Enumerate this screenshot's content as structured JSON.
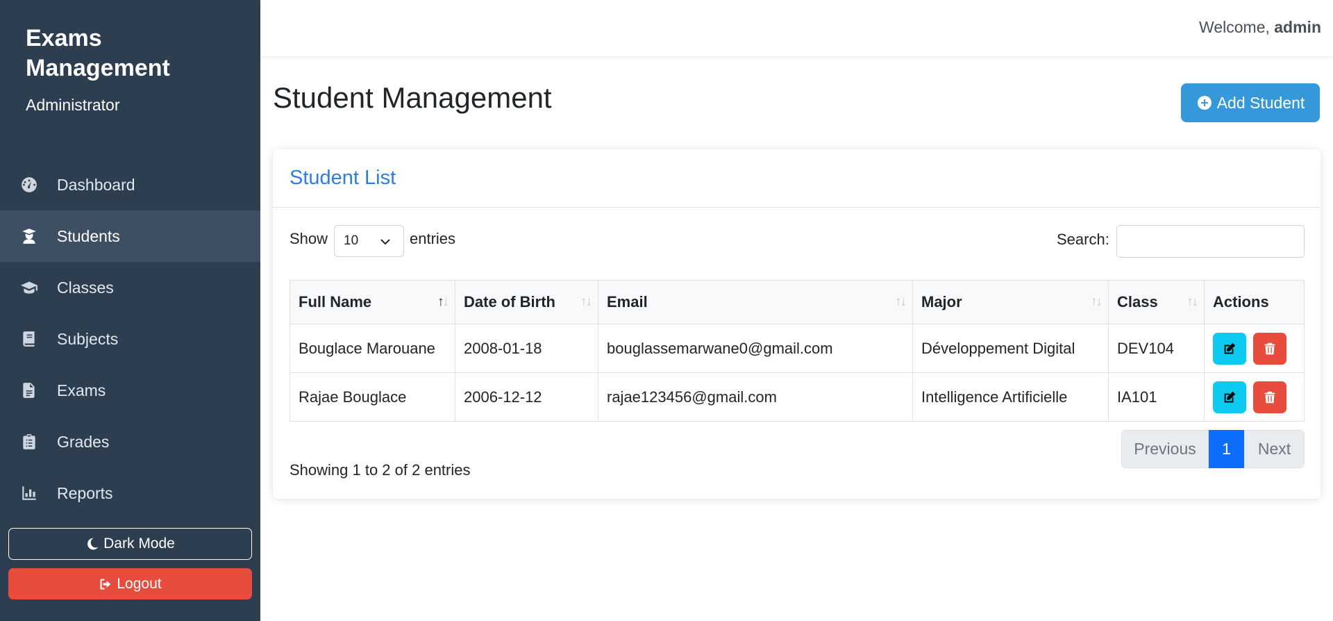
{
  "sidebar": {
    "brand_title": "Exams Management",
    "brand_subtitle": "Administrator",
    "items": [
      {
        "label": "Dashboard",
        "icon": "dashboard-gauge-icon"
      },
      {
        "label": "Students",
        "icon": "student-icon",
        "active": true
      },
      {
        "label": "Classes",
        "icon": "graduation-cap-icon"
      },
      {
        "label": "Subjects",
        "icon": "book-icon"
      },
      {
        "label": "Exams",
        "icon": "file-icon"
      },
      {
        "label": "Grades",
        "icon": "clipboard-icon"
      },
      {
        "label": "Reports",
        "icon": "bar-chart-icon"
      }
    ],
    "dark_mode_label": "Dark Mode",
    "logout_label": "Logout"
  },
  "header": {
    "welcome_prefix": "Welcome,",
    "username": "admin"
  },
  "main": {
    "page_title": "Student Management",
    "add_button_label": "Add Student",
    "card_title": "Student List",
    "show_label": "Show",
    "entries_value": "10",
    "entries_label": "entries",
    "search_label": "Search:",
    "search_value": "",
    "table": {
      "columns": [
        "Full Name",
        "Date of Birth",
        "Email",
        "Major",
        "Class",
        "Actions"
      ],
      "rows": [
        [
          "Bouglace Marouane",
          "2008-01-18",
          "bouglassemarwane0@gmail.com",
          "Développement Digital",
          "DEV104"
        ],
        [
          "Rajae Bouglace",
          "2006-12-12",
          "rajae123456@gmail.com",
          "Intelligence Artificielle",
          "IA101"
        ]
      ]
    },
    "info_text": "Showing 1 to 2 of 2 entries",
    "pagination": {
      "previous": "Previous",
      "current": "1",
      "next": "Next"
    }
  },
  "colors": {
    "sidebar_bg": "#2c3e50",
    "accent_blue": "#3498db",
    "danger": "#e74c3c",
    "info": "#0dcaf0",
    "primary": "#0d6efd"
  }
}
